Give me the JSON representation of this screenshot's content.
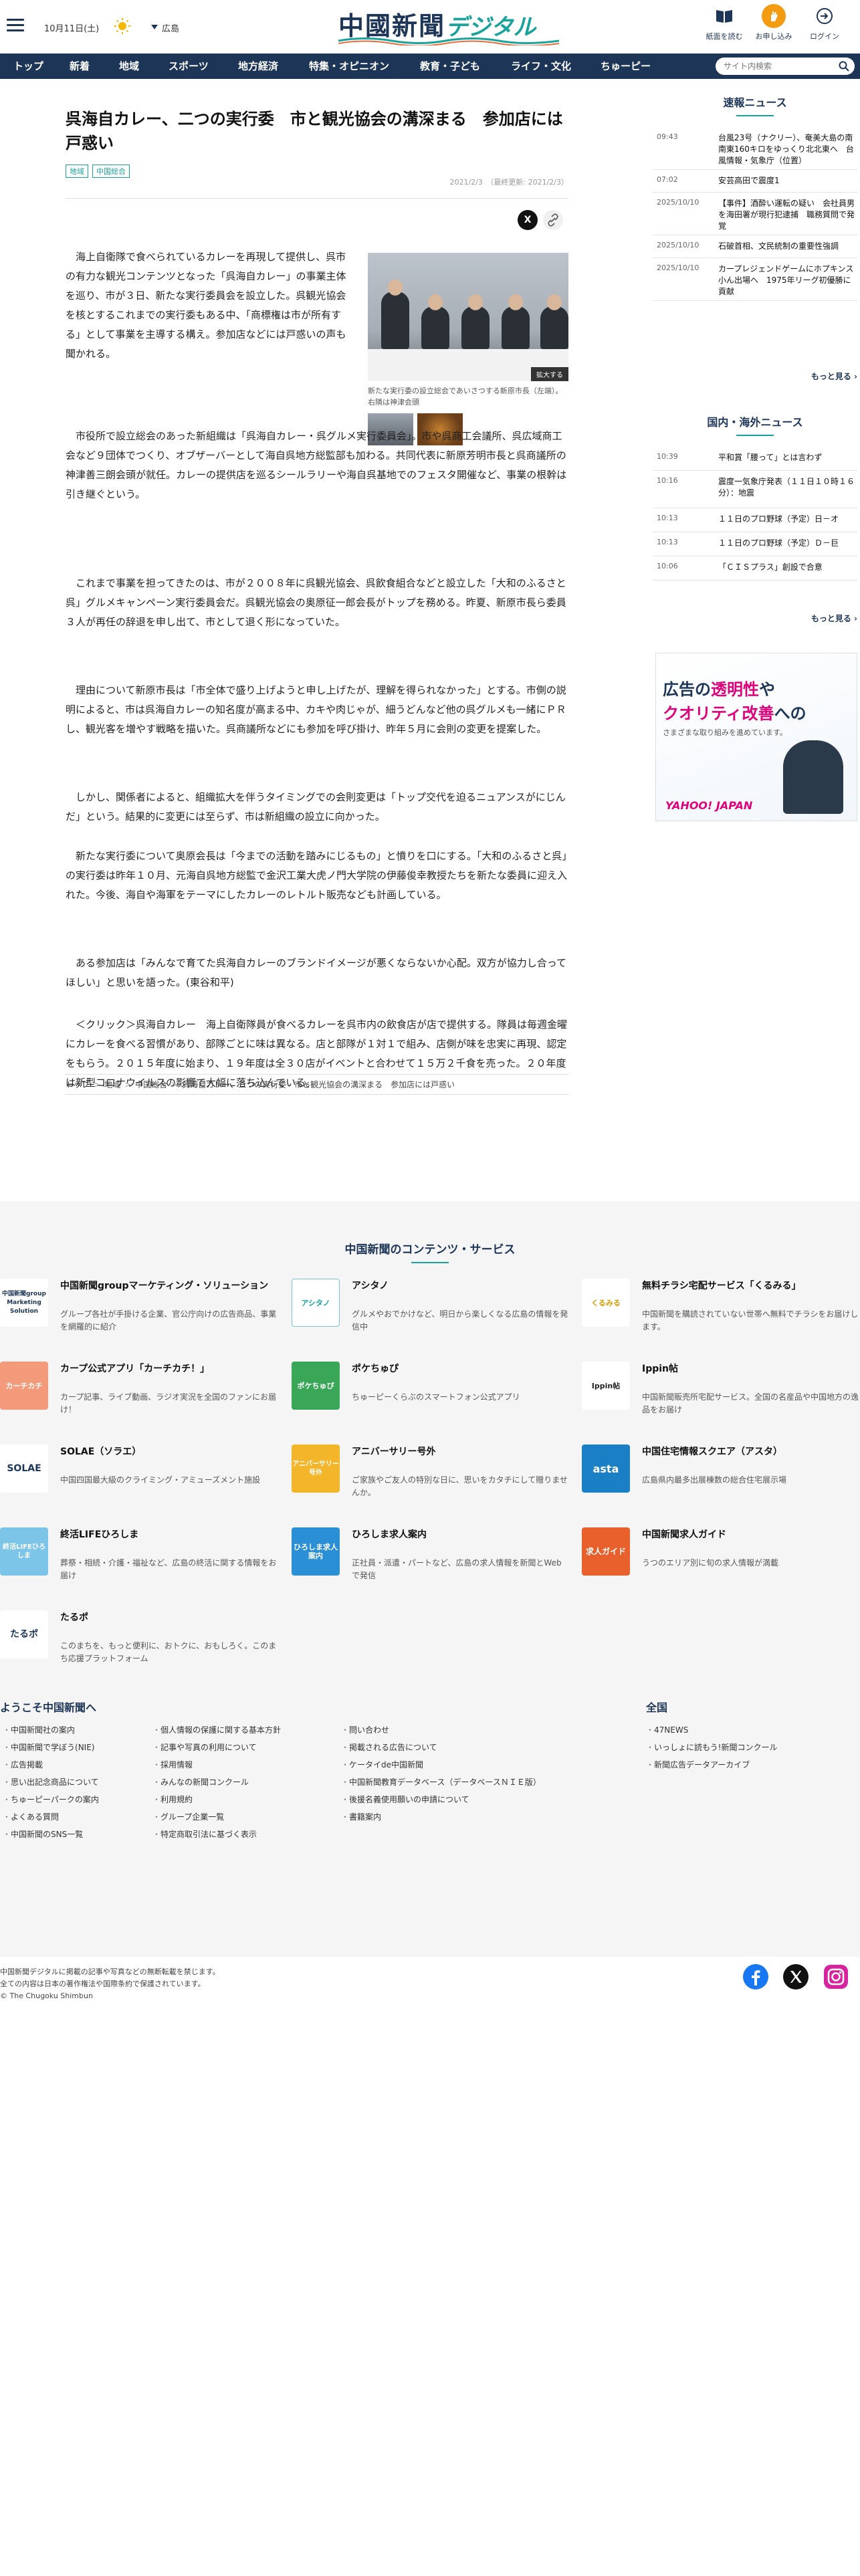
{
  "header": {
    "date": "10月11日(土)",
    "region": "広島",
    "logo_main": "中國新聞",
    "logo_sub": "デジタル",
    "buttons": [
      {
        "label": "紙面を読む"
      },
      {
        "label": "お申し込み"
      },
      {
        "label": "ログイン"
      }
    ],
    "accent_color": "#1aa39a",
    "brand_color": "#1d3557"
  },
  "nav": {
    "items": [
      "トップ",
      "新着",
      "地域",
      "スポーツ",
      "地方経済",
      "特集・オピニオン",
      "教育・子ども",
      "ライフ・文化",
      "ちゅーピー"
    ],
    "search_placeholder": "サイト内検索"
  },
  "article": {
    "title": "呉海自カレー、二つの実行委　市と観光協会の溝深まる　参加店には戸惑い",
    "tags": [
      "地域",
      "中国総合"
    ],
    "date": "2021/2/3",
    "updated": "（最終更新: 2021/2/3）",
    "share_x": "X",
    "zoom_label": "拡大する",
    "caption": "新たな実行委の設立総会であいさつする新原市長（左端）。右隣は神津会頭",
    "paragraphs": [
      "海上自衛隊で食べられているカレーを再現して提供し、呉市の有力な観光コンテンツとなった「呉海自カレー」の事業主体を巡り、市が３日、新たな実行委員会を設立した。呉観光協会を核とするこれまでの実行委もある中、「商標権は市が所有する」として事業を主導する構え。参加店などには戸惑いの声も聞かれる。",
      "市役所で設立総会のあった新組織は「呉海自カレー・呉グルメ実行委員会」。市や呉商工会議所、呉広域商工会など９団体でつくり、オブザーバーとして海自呉地方総監部も加わる。共同代表に新原芳明市長と呉商議所の神津善三朗会頭が就任。カレーの提供店を巡るシールラリーや海自呉基地でのフェスタ開催など、事業の根幹は引き継ぐという。",
      "これまで事業を担ってきたのは、市が２００８年に呉観光協会、呉飲食組合などと設立した「大和のふるさと呉」グルメキャンペーン実行委員会だ。呉観光協会の奥原征一郎会長がトップを務める。昨夏、新原市長ら委員３人が再任の辞退を申し出て、市として退く形になっていた。",
      "理由について新原市長は「市全体で盛り上げようと申し上げたが、理解を得られなかった」とする。市側の説明によると、市は呉海自カレーの知名度が高まる中、カキや肉じゃが、細うどんなど他の呉グルメも一緒にＰＲし、観光客を増やす戦略を描いた。呉商議所などにも参加を呼び掛け、昨年５月に会則の変更を提案した。",
      "しかし、関係者によると、組織拡大を伴うタイミングでの会則変更は「トップ交代を迫るニュアンスがにじんだ」という。結果的に変更には至らず、市は新組織の設立に向かった。",
      "新たな実行委について奥原会長は「今までの活動を踏みにじるもの」と憤りを口にする。「大和のふるさと呉」の実行委は昨年１０月、元海自呉地方総監で金沢工業大虎ノ門大学院の伊藤俊幸教授たちを新たな委員に迎え入れた。今後、海自や海軍をテーマにしたカレーのレトルト販売なども計画している。",
      "ある参加店は「みんなで育てた呉海自カレーのブランドイメージが悪くならないか心配。双方が協力し合ってほしい」と思いを語った。(東谷和平)",
      "＜クリック＞呉海自カレー　海上自衛隊員が食べるカレーを呉市内の飲食店が店で提供する。隊員は毎週金曜にカレーを食べる習慣があり、部隊ごとに味は異なる。店と部隊が１対１で組み、店側が味を忠実に再現、認定をもらう。２０１５年度に始まり、１９年度は全３０店がイベントと合わせて１５万２千食を売った。２０年度は新型コロナウイルスの影響で大幅に落ち込んでいる。"
    ],
    "breadcrumb": [
      "トップ",
      "地域",
      "中国総合",
      "呉海自カレー、二つの実行委　市と観光協会の溝深まる　参加店には戸惑い"
    ]
  },
  "sidebar": {
    "breaking_title": "速報ニュース",
    "breaking": [
      {
        "time": "09:43",
        "headline": "台風23号（ナクリー）、奄美大島の南南東160キロをゆっくり北北東へ　台風情報・気象庁（位置）"
      },
      {
        "time": "07:02",
        "headline": "安芸高田で震度1"
      },
      {
        "time": "2025/10/10",
        "headline": "【事件】酒酔い運転の疑い　会社員男を海田署が現行犯逮捕　職務質問で発覚"
      },
      {
        "time": "2025/10/10",
        "headline": "石破首相、文民統制の重要性強調"
      },
      {
        "time": "2025/10/10",
        "headline": "カープレジェンドゲームにホプキンス小ん出場へ　1975年リーグ初優勝に貢献"
      }
    ],
    "domestic_title": "国内・海外ニュース",
    "domestic": [
      {
        "time": "10:39",
        "headline": "平和賞「腰って」とは言わず"
      },
      {
        "time": "10:16",
        "headline": "震度一気象庁発表（１１日１０時１６分）：地震"
      },
      {
        "time": "10:13",
        "headline": "１１日のプロ野球（予定）日－オ"
      },
      {
        "time": "10:13",
        "headline": "１１日のプロ野球（予定）Ｄ－巨"
      },
      {
        "time": "10:06",
        "headline": "「ＣＩＳプラス」創設で合意"
      }
    ],
    "more_label": "もっと見る",
    "ad": {
      "line1_a": "広告の",
      "line1_b": "透明性",
      "line1_c": "や",
      "line2_a": "クオリティ改善",
      "line2_b": "への",
      "line3": "さまざまな取り組みを進めています。",
      "brand": "YAHOO! JAPAN"
    }
  },
  "footer": {
    "services_title": "中国新聞のコンテンツ・サービス",
    "services": [
      {
        "name": "中国新聞groupマーケティング・ソリューション",
        "desc": "グループ各社が手掛ける企業、官公庁向けの広告商品、事業を網羅的に紹介",
        "logo": "中国新聞group Marketing Solution"
      },
      {
        "name": "アシタノ",
        "desc": "グルメやおでかけなど、明日から楽しくなる広島の情報を発信中",
        "logo": "アシタノ"
      },
      {
        "name": "無料チラシ宅配サービス「くるみる」",
        "desc": "中国新聞を購読されていない世帯へ無料でチラシをお届けします。",
        "logo": "くるみる"
      },
      {
        "name": "カープ公式アプリ「カーチカチ！」",
        "desc": "カープ記事、ライブ動画、ラジオ実況を全国のファンにお届け！",
        "logo": "カーチカチ"
      },
      {
        "name": "ポケちゅぴ",
        "desc": "ちゅーピーくらぶのスマートフォン公式アプリ",
        "logo": "ポケちゅぴ"
      },
      {
        "name": "Ippin帖",
        "desc": "中国新聞販売所宅配サービス。全国の名産品や中国地方の逸品をお届け",
        "logo": "Ippin帖"
      },
      {
        "name": "SOLAE（ソラエ）",
        "desc": "中国四国最大級のクライミング・アミューズメント施設",
        "logo": "SOLAE"
      },
      {
        "name": "アニバーサリー号外",
        "desc": "ご家族やご友人の特別な日に、思いをカタチにして贈りませんか。",
        "logo": "アニバーサリー号外"
      },
      {
        "name": "中国住宅情報スクエア（アスタ）",
        "desc": "広島県内最多出展棟数の総合住宅展示場",
        "logo": "asta"
      },
      {
        "name": "終活LIFEひろしま",
        "desc": "葬祭・相続・介護・福祉など、広島の終活に関する情報をお届け",
        "logo": "終活LIFEひろしま"
      },
      {
        "name": "ひろしま求人案内",
        "desc": "正社員・派遣・パートなど、広島の求人情報を新聞とWebで発信",
        "logo": "ひろしま求人案内"
      },
      {
        "name": "中国新聞求人ガイド",
        "desc": "うつのエリア別に旬の求人情報が満載",
        "logo": "求人ガイド"
      },
      {
        "name": "たるポ",
        "desc": "このまちを、もっと便利に、おトクに、おもしろく。このまち応援プラットフォーム",
        "logo": "たるポ"
      }
    ],
    "welcome_title": "ようこそ中国新聞へ",
    "zenkoku_title": "全国",
    "links_col1": [
      "中国新聞社の案内",
      "中国新聞で学ぼう(NIE)",
      "広告掲載",
      "思い出記念商品について",
      "ちゅーピーパークの案内",
      "よくある質問",
      "中国新聞のSNS一覧"
    ],
    "links_col2": [
      "個人情報の保護に関する基本方針",
      "記事や写真の利用について",
      "採用情報",
      "みんなの新聞コンクール",
      "利用規約",
      "グループ企業一覧",
      "特定商取引法に基づく表示"
    ],
    "links_col3": [
      "問い合わせ",
      "掲載される広告について",
      "ケータイde中国新聞",
      "中国新聞教育データベース（データベースＮＩＥ版）",
      "後援名義使用願いの申請について",
      "書籍案内"
    ],
    "links_col4": [
      "47NEWS",
      "いっしょに読もう!新聞コンクール",
      "新聞広告データアーカイブ"
    ],
    "copyright_1": "中国新聞デジタルに掲載の記事や写真などの無断転載を禁じます。",
    "copyright_2": "全ての内容は日本の著作権法や国際条約で保護されています。",
    "copyright_3": "© The Chugoku Shimbun"
  }
}
